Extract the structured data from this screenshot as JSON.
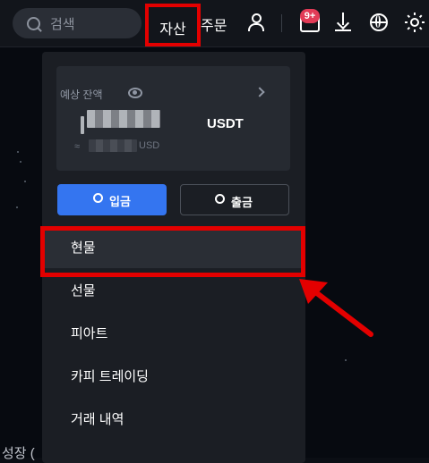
{
  "topbar": {
    "search_placeholder": "검색",
    "nav_assets": "자산",
    "nav_orders": "주문",
    "notification_badge": "9+"
  },
  "dropdown": {
    "balance_label": "예상 잔액",
    "balance_currency": "USDT",
    "approx_symbol": "≈",
    "usd_currency": "USD",
    "deposit_label": "입금",
    "withdraw_label": "출금",
    "menu": [
      {
        "label": "현물"
      },
      {
        "label": "선물"
      },
      {
        "label": "피아트"
      },
      {
        "label": "카피 트레이딩"
      },
      {
        "label": "거래 내역"
      }
    ]
  },
  "annotations": {
    "highlight_color": "#e30000"
  },
  "background": {
    "partial_text": "성장 ("
  }
}
